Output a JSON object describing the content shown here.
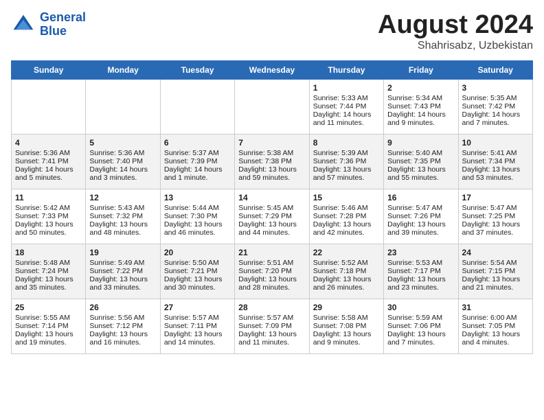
{
  "header": {
    "logo_line1": "General",
    "logo_line2": "Blue",
    "main_title": "August 2024",
    "subtitle": "Shahrisabz, Uzbekistan"
  },
  "days_of_week": [
    "Sunday",
    "Monday",
    "Tuesday",
    "Wednesday",
    "Thursday",
    "Friday",
    "Saturday"
  ],
  "weeks": [
    [
      {
        "day": "",
        "info": ""
      },
      {
        "day": "",
        "info": ""
      },
      {
        "day": "",
        "info": ""
      },
      {
        "day": "",
        "info": ""
      },
      {
        "day": "1",
        "info": "Sunrise: 5:33 AM\nSunset: 7:44 PM\nDaylight: 14 hours\nand 11 minutes."
      },
      {
        "day": "2",
        "info": "Sunrise: 5:34 AM\nSunset: 7:43 PM\nDaylight: 14 hours\nand 9 minutes."
      },
      {
        "day": "3",
        "info": "Sunrise: 5:35 AM\nSunset: 7:42 PM\nDaylight: 14 hours\nand 7 minutes."
      }
    ],
    [
      {
        "day": "4",
        "info": "Sunrise: 5:36 AM\nSunset: 7:41 PM\nDaylight: 14 hours\nand 5 minutes."
      },
      {
        "day": "5",
        "info": "Sunrise: 5:36 AM\nSunset: 7:40 PM\nDaylight: 14 hours\nand 3 minutes."
      },
      {
        "day": "6",
        "info": "Sunrise: 5:37 AM\nSunset: 7:39 PM\nDaylight: 14 hours\nand 1 minute."
      },
      {
        "day": "7",
        "info": "Sunrise: 5:38 AM\nSunset: 7:38 PM\nDaylight: 13 hours\nand 59 minutes."
      },
      {
        "day": "8",
        "info": "Sunrise: 5:39 AM\nSunset: 7:36 PM\nDaylight: 13 hours\nand 57 minutes."
      },
      {
        "day": "9",
        "info": "Sunrise: 5:40 AM\nSunset: 7:35 PM\nDaylight: 13 hours\nand 55 minutes."
      },
      {
        "day": "10",
        "info": "Sunrise: 5:41 AM\nSunset: 7:34 PM\nDaylight: 13 hours\nand 53 minutes."
      }
    ],
    [
      {
        "day": "11",
        "info": "Sunrise: 5:42 AM\nSunset: 7:33 PM\nDaylight: 13 hours\nand 50 minutes."
      },
      {
        "day": "12",
        "info": "Sunrise: 5:43 AM\nSunset: 7:32 PM\nDaylight: 13 hours\nand 48 minutes."
      },
      {
        "day": "13",
        "info": "Sunrise: 5:44 AM\nSunset: 7:30 PM\nDaylight: 13 hours\nand 46 minutes."
      },
      {
        "day": "14",
        "info": "Sunrise: 5:45 AM\nSunset: 7:29 PM\nDaylight: 13 hours\nand 44 minutes."
      },
      {
        "day": "15",
        "info": "Sunrise: 5:46 AM\nSunset: 7:28 PM\nDaylight: 13 hours\nand 42 minutes."
      },
      {
        "day": "16",
        "info": "Sunrise: 5:47 AM\nSunset: 7:26 PM\nDaylight: 13 hours\nand 39 minutes."
      },
      {
        "day": "17",
        "info": "Sunrise: 5:47 AM\nSunset: 7:25 PM\nDaylight: 13 hours\nand 37 minutes."
      }
    ],
    [
      {
        "day": "18",
        "info": "Sunrise: 5:48 AM\nSunset: 7:24 PM\nDaylight: 13 hours\nand 35 minutes."
      },
      {
        "day": "19",
        "info": "Sunrise: 5:49 AM\nSunset: 7:22 PM\nDaylight: 13 hours\nand 33 minutes."
      },
      {
        "day": "20",
        "info": "Sunrise: 5:50 AM\nSunset: 7:21 PM\nDaylight: 13 hours\nand 30 minutes."
      },
      {
        "day": "21",
        "info": "Sunrise: 5:51 AM\nSunset: 7:20 PM\nDaylight: 13 hours\nand 28 minutes."
      },
      {
        "day": "22",
        "info": "Sunrise: 5:52 AM\nSunset: 7:18 PM\nDaylight: 13 hours\nand 26 minutes."
      },
      {
        "day": "23",
        "info": "Sunrise: 5:53 AM\nSunset: 7:17 PM\nDaylight: 13 hours\nand 23 minutes."
      },
      {
        "day": "24",
        "info": "Sunrise: 5:54 AM\nSunset: 7:15 PM\nDaylight: 13 hours\nand 21 minutes."
      }
    ],
    [
      {
        "day": "25",
        "info": "Sunrise: 5:55 AM\nSunset: 7:14 PM\nDaylight: 13 hours\nand 19 minutes."
      },
      {
        "day": "26",
        "info": "Sunrise: 5:56 AM\nSunset: 7:12 PM\nDaylight: 13 hours\nand 16 minutes."
      },
      {
        "day": "27",
        "info": "Sunrise: 5:57 AM\nSunset: 7:11 PM\nDaylight: 13 hours\nand 14 minutes."
      },
      {
        "day": "28",
        "info": "Sunrise: 5:57 AM\nSunset: 7:09 PM\nDaylight: 13 hours\nand 11 minutes."
      },
      {
        "day": "29",
        "info": "Sunrise: 5:58 AM\nSunset: 7:08 PM\nDaylight: 13 hours\nand 9 minutes."
      },
      {
        "day": "30",
        "info": "Sunrise: 5:59 AM\nSunset: 7:06 PM\nDaylight: 13 hours\nand 7 minutes."
      },
      {
        "day": "31",
        "info": "Sunrise: 6:00 AM\nSunset: 7:05 PM\nDaylight: 13 hours\nand 4 minutes."
      }
    ]
  ]
}
